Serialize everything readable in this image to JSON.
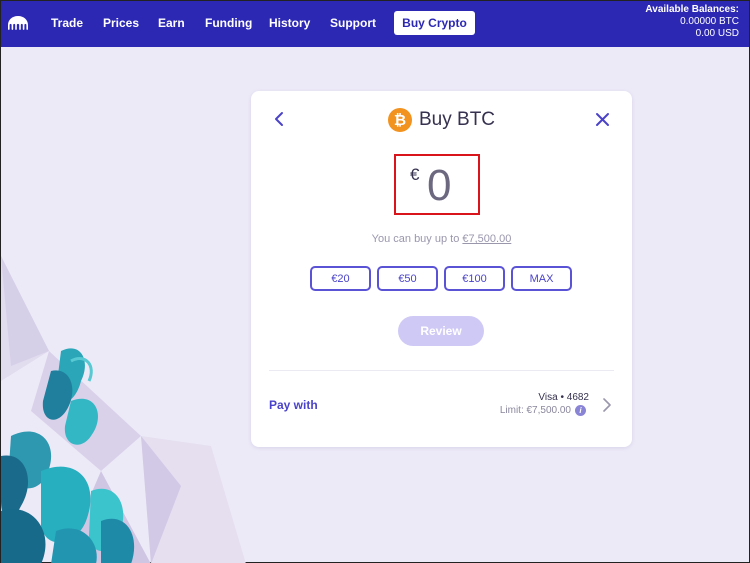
{
  "nav": {
    "items": [
      "Trade",
      "Prices",
      "Earn",
      "Funding",
      "History",
      "Support"
    ],
    "active": "Buy Crypto"
  },
  "balances": {
    "title": "Available Balances:",
    "btc": "0.00000 BTC",
    "usd": "0.00 USD"
  },
  "card": {
    "title": "Buy BTC",
    "coin_symbol": "₿",
    "currency": "€",
    "amount": "0",
    "limit_text": "You can buy up to",
    "limit_value": "€7,500.00",
    "presets": [
      "€20",
      "€50",
      "€100",
      "MAX"
    ],
    "review_label": "Review",
    "pay_with_label": "Pay with",
    "payment_card": "Visa • 4682",
    "payment_limit": "Limit: €7,500.00",
    "info_symbol": "i"
  },
  "colors": {
    "nav_bg": "#2c28b4",
    "accent": "#5b53d6",
    "btc_orange": "#f2921f",
    "highlight_border": "#d9141b",
    "page_bg": "#edeaf8"
  }
}
